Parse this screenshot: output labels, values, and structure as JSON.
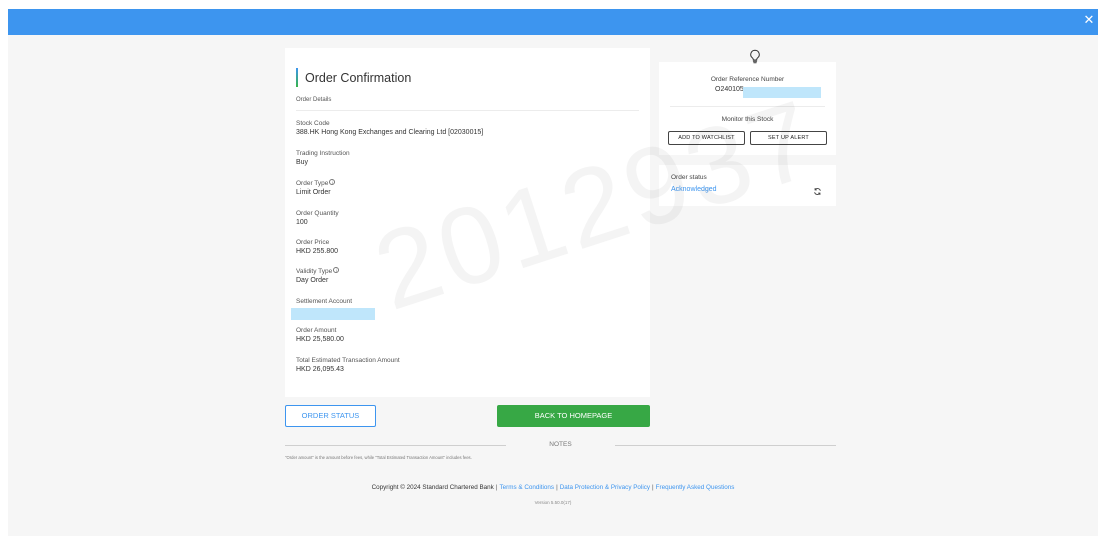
{
  "window": {
    "close_glyph": "✕",
    "close_icon": "close-icon"
  },
  "watermark": "2012937",
  "order": {
    "title": "Order Confirmation",
    "section": "Order Details",
    "fields": [
      {
        "label": "Stock Code",
        "value": "388.HK Hong Kong Exchanges and Clearing Ltd [02030015]"
      },
      {
        "label": "Trading Instruction",
        "value": "Buy"
      },
      {
        "label": "Order Type",
        "value": "Limit Order",
        "info_icon": true
      },
      {
        "label": "Order Quantity",
        "value": "100"
      },
      {
        "label": "Order Price",
        "value": "HKD 255.800"
      },
      {
        "label": "Validity Type",
        "value": "Day Order",
        "info_icon": true
      },
      {
        "label": "Settlement Account",
        "value": "",
        "redacted": true
      },
      {
        "label": "Order Amount",
        "value": "HKD 25,580.00"
      },
      {
        "label": "Total Estimated Transaction Amount",
        "value": "HKD 26,095.43"
      }
    ]
  },
  "reference": {
    "icon": "lightbulb-icon",
    "label": "Order Reference Number",
    "value_prefix": "O240105",
    "monitor_label": "Monitor this Stock",
    "watchlist_button": "ADD TO WATCHLIST",
    "alert_button": "SET UP ALERT"
  },
  "status": {
    "label": "Order status",
    "value": "Acknowledged",
    "refresh_icon": "refresh-icon"
  },
  "actions": {
    "order_status_button": "ORDER STATUS",
    "homepage_button": "BACK TO HOMEPAGE"
  },
  "notes": {
    "heading": "NOTES",
    "text": "\"Order amount\" is the amount before fees, while \"Total Estimated Transaction Amount\" includes fees."
  },
  "footer": {
    "copyright": "Copyright © 2024 Standard Chartered Bank",
    "links": [
      "Terms & Conditions",
      "Data Protection & Privacy Policy",
      "Frequently Asked Questions"
    ],
    "version": "Version 5.50.0(17)"
  },
  "colors": {
    "topbar": "#3d95ef",
    "accent_blue": "#3d95ef",
    "green_button": "#37a845",
    "redaction": "#bfe6fb"
  }
}
